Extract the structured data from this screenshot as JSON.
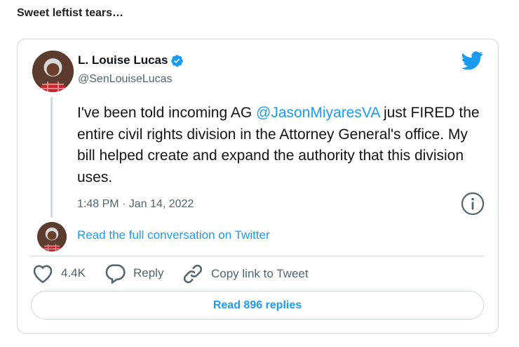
{
  "post": {
    "title": "Sweet leftist tears…"
  },
  "tweet": {
    "author_name": "L. Louise Lucas",
    "handle": "@SenLouiseLucas",
    "text_before": "I've been told incoming AG ",
    "mention": "@JasonMiyaresVA",
    "text_after": " just FIRED the entire civil rights division in the Attorney General's office.  My bill helped create and expand the authority that this division uses.",
    "timestamp": "1:48 PM · Jan 14, 2022",
    "read_conversation": "Read the full conversation on Twitter"
  },
  "actions": {
    "like_count": "4.4K",
    "reply_label": "Reply",
    "copy_label": "Copy link to Tweet",
    "read_replies": "Read 896 replies"
  },
  "colors": {
    "link": "#1d9bf0",
    "text": "#0f1419",
    "secondary": "#536471",
    "border": "#cfd9de"
  },
  "icons": [
    "verified-badge-icon",
    "twitter-bird-icon",
    "info-icon",
    "heart-icon",
    "reply-bubble-icon",
    "link-icon"
  ]
}
